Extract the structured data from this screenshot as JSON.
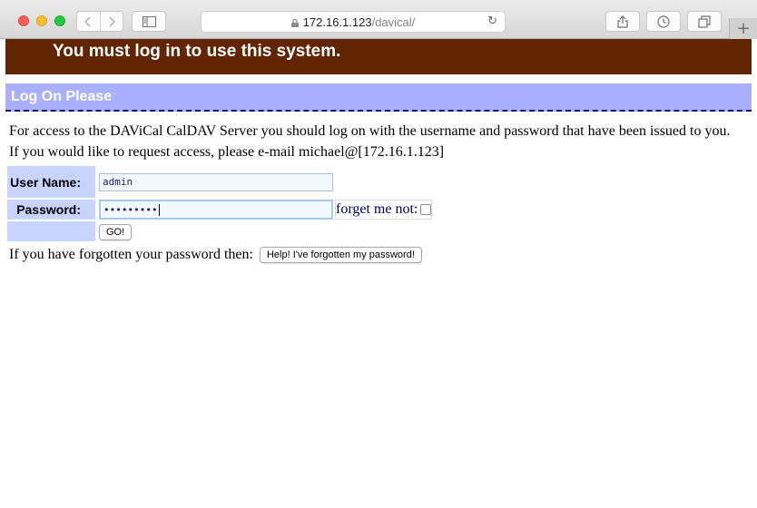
{
  "browser": {
    "url_host": "172.16.1.123",
    "url_path": "/davical/",
    "icons": {
      "back": "chevron-left-icon",
      "forward": "chevron-right-icon",
      "sidebar": "sidebar-icon",
      "lock": "lock-icon",
      "reload": "reload-icon",
      "share": "share-icon",
      "history": "history-icon",
      "tabs": "tabs-icon",
      "new_tab": "plus-icon"
    }
  },
  "banner": {
    "message": "You must log in to use this system."
  },
  "login": {
    "header": "Log On Please",
    "intro_line1": "For access to the DAViCal CalDAV Server you should log on with the username and password that have been issued to you.",
    "intro_line2": "If you would like to request access, please e-mail michael@[172.16.1.123]",
    "username_label": "User Name:",
    "username_value": "admin",
    "password_label": "Password:",
    "password_value": "•••••••••",
    "forget_me_not_label": "forget me not:",
    "go_button": "GO!",
    "forgot_text": "If you have forgotten your password then:",
    "forgot_button": "Help! I've forgotten my password!"
  },
  "colors": {
    "banner_bg": "#612500",
    "header_bg": "#aab0ff",
    "label_bg": "#c8d4ff"
  }
}
